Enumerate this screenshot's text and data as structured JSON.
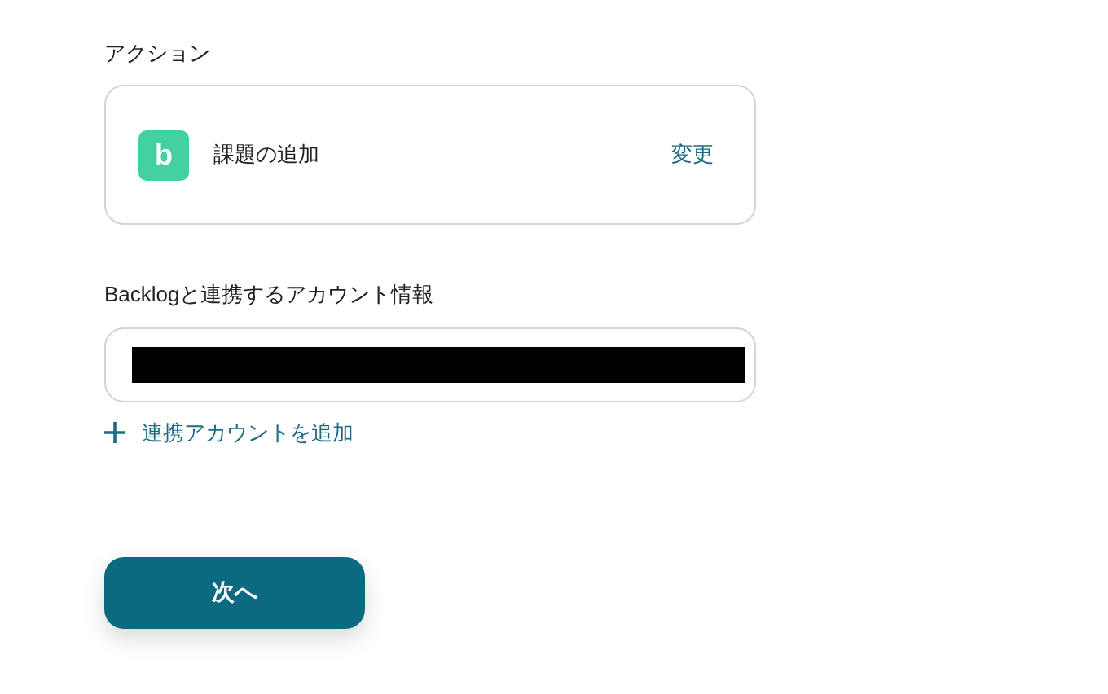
{
  "action_section": {
    "label": "アクション",
    "app_icon_letter": "b",
    "action_name": "課題の追加",
    "change_link": "変更"
  },
  "account_section": {
    "label": "Backlogと連携するアカウント情報",
    "redacted": true,
    "add_link": "連携アカウントを追加"
  },
  "next_button": "次へ"
}
